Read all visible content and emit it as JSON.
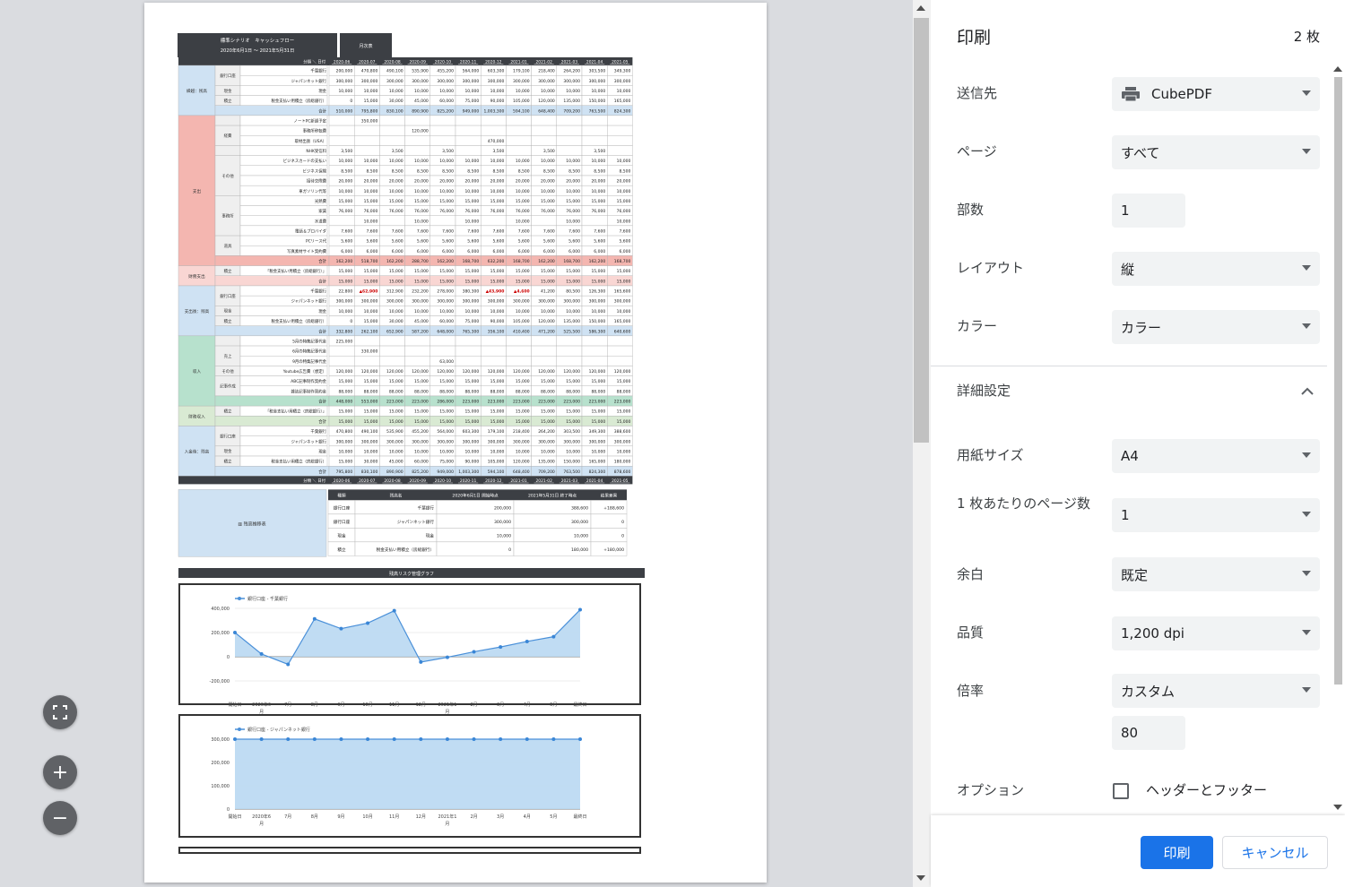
{
  "preview": {
    "scenario_title": "標準シナリオ　キャッシュフロー",
    "period": "2020年6月1日 ～ 2021年5月31日",
    "month_table_label": "月次表",
    "corner_label": "分類 ＼ 日付",
    "months": [
      "2020-06",
      "2020-07",
      "2020-08",
      "2020-09",
      "2020-10",
      "2020-11",
      "2020-12",
      "2021-01",
      "2021-02",
      "2021-03",
      "2021-04",
      "2021-05"
    ],
    "total_label": "合計",
    "groups": [
      {
        "label": "繰越：残高",
        "color": "#cfe2f3",
        "rows": [
          {
            "sub": "銀行口座",
            "item": "千葉銀行",
            "vals": [
              "200,000",
              "470,800",
              "490,100",
              "535,900",
              "455,200",
              "564,000",
              "603,300",
              "179,100",
              "218,400",
              "264,200",
              "303,500",
              "349,300"
            ]
          },
          {
            "sub": "銀行口座",
            "item": "ジャパンネット銀行",
            "vals": [
              "300,000",
              "300,000",
              "300,000",
              "300,000",
              "300,000",
              "300,000",
              "300,000",
              "300,000",
              "300,000",
              "300,000",
              "300,000",
              "300,000"
            ]
          },
          {
            "sub": "現金",
            "item": "現金",
            "vals": [
              "10,000",
              "10,000",
              "10,000",
              "10,000",
              "10,000",
              "10,000",
              "10,000",
              "10,000",
              "10,000",
              "10,000",
              "10,000",
              "10,000"
            ]
          },
          {
            "sub": "積立",
            "item": "税金支払い用積立（房総銀行）",
            "vals": [
              "0",
              "15,000",
              "30,000",
              "45,000",
              "60,000",
              "75,000",
              "90,000",
              "105,000",
              "120,000",
              "135,000",
              "150,000",
              "165,000"
            ]
          }
        ],
        "total": [
          "510,000",
          "795,800",
          "830,100",
          "890,900",
          "825,200",
          "949,000",
          "1,003,300",
          "594,100",
          "648,400",
          "709,200",
          "763,500",
          "824,300"
        ]
      },
      {
        "label": "支出",
        "color": "#f4b6b0",
        "rows": [
          {
            "sub": "",
            "item": "ノートPC新調予定",
            "vals": [
              "",
              "350,000",
              "",
              "",
              "",
              "",
              "",
              "",
              "",
              "",
              "",
              ""
            ]
          },
          {
            "sub": "経費",
            "item": "事務所移転費",
            "vals": [
              "",
              "",
              "",
              "120,000",
              "",
              "",
              "",
              "",
              "",
              "",
              "",
              ""
            ]
          },
          {
            "sub": "経費",
            "item": "取材出張（USA）",
            "vals": [
              "",
              "",
              "",
              "",
              "",
              "",
              "470,000",
              "",
              "",
              "",
              "",
              ""
            ]
          },
          {
            "sub": "",
            "item": "NHK受信料",
            "vals": [
              "3,500",
              "",
              "3,500",
              "",
              "3,500",
              "",
              "3,500",
              "",
              "3,500",
              "",
              "3,500",
              ""
            ]
          },
          {
            "sub": "その他",
            "item": "ビジネスカードの支払い",
            "vals": [
              "10,000",
              "10,000",
              "10,000",
              "10,000",
              "10,000",
              "10,000",
              "10,000",
              "10,000",
              "10,000",
              "10,000",
              "10,000",
              "10,000"
            ]
          },
          {
            "sub": "その他",
            "item": "ビジネス保険",
            "vals": [
              "8,500",
              "8,500",
              "8,500",
              "8,500",
              "8,500",
              "8,500",
              "8,500",
              "8,500",
              "8,500",
              "8,500",
              "8,500",
              "8,500"
            ]
          },
          {
            "sub": "その他",
            "item": "接待交際費",
            "vals": [
              "20,000",
              "20,000",
              "20,000",
              "20,000",
              "20,000",
              "20,000",
              "20,000",
              "20,000",
              "20,000",
              "20,000",
              "20,000",
              "20,000"
            ]
          },
          {
            "sub": "その他",
            "item": "車ガソリン代等",
            "vals": [
              "10,000",
              "10,000",
              "10,000",
              "10,000",
              "10,000",
              "10,000",
              "10,000",
              "10,000",
              "10,000",
              "10,000",
              "10,000",
              "10,000"
            ]
          },
          {
            "sub": "事務所",
            "item": "光熱費",
            "vals": [
              "15,000",
              "15,000",
              "15,000",
              "15,000",
              "15,000",
              "15,000",
              "15,000",
              "15,000",
              "15,000",
              "15,000",
              "15,000",
              "15,000"
            ]
          },
          {
            "sub": "事務所",
            "item": "家賃",
            "vals": [
              "76,000",
              "76,000",
              "76,000",
              "76,000",
              "76,000",
              "76,000",
              "76,000",
              "76,000",
              "76,000",
              "76,000",
              "76,000",
              "76,000"
            ]
          },
          {
            "sub": "事務所",
            "item": "水道費",
            "vals": [
              "",
              "10,000",
              "",
              "10,000",
              "",
              "10,000",
              "",
              "10,000",
              "",
              "10,000",
              "",
              "10,000"
            ]
          },
          {
            "sub": "事務所",
            "item": "電話＆プロバイダ",
            "vals": [
              "7,600",
              "7,600",
              "7,600",
              "7,600",
              "7,600",
              "7,600",
              "7,600",
              "7,600",
              "7,600",
              "7,600",
              "7,600",
              "7,600"
            ]
          },
          {
            "sub": "道具",
            "item": "PCリース代",
            "vals": [
              "5,600",
              "5,600",
              "5,600",
              "5,600",
              "5,600",
              "5,600",
              "5,600",
              "5,600",
              "5,600",
              "5,600",
              "5,600",
              "5,600"
            ]
          },
          {
            "sub": "道具",
            "item": "写真素材サイト契約費",
            "vals": [
              "6,000",
              "6,000",
              "6,000",
              "6,000",
              "6,000",
              "6,000",
              "6,000",
              "6,000",
              "6,000",
              "6,000",
              "6,000",
              "6,000"
            ]
          }
        ],
        "total": [
          "162,200",
          "518,700",
          "162,200",
          "288,700",
          "162,200",
          "168,700",
          "632,200",
          "168,700",
          "162,200",
          "168,700",
          "162,200",
          "168,700"
        ]
      },
      {
        "label": "財務支出",
        "color": "#f9d6d3",
        "rows": [
          {
            "sub": "積立",
            "item": "「税金支払い用積立（房総銀行）」",
            "vals": [
              "15,000",
              "15,000",
              "15,000",
              "15,000",
              "15,000",
              "15,000",
              "15,000",
              "15,000",
              "15,000",
              "15,000",
              "15,000",
              "15,000"
            ]
          }
        ],
        "total": [
          "15,000",
          "15,000",
          "15,000",
          "15,000",
          "15,000",
          "15,000",
          "15,000",
          "15,000",
          "15,000",
          "15,000",
          "15,000",
          "15,000"
        ]
      },
      {
        "label": "支出後：残高",
        "color": "#cfe2f3",
        "rows": [
          {
            "sub": "銀行口座",
            "item": "千葉銀行",
            "vals": [
              "22,800",
              "▲62,900",
              "312,900",
              "232,200",
              "278,000",
              "380,300",
              "▲43,900",
              "▲4,600",
              "41,200",
              "80,500",
              "126,300",
              "165,600"
            ]
          },
          {
            "sub": "銀行口座",
            "item": "ジャパンネット銀行",
            "vals": [
              "300,000",
              "300,000",
              "300,000",
              "300,000",
              "300,000",
              "300,000",
              "300,000",
              "300,000",
              "300,000",
              "300,000",
              "300,000",
              "300,000"
            ]
          },
          {
            "sub": "現金",
            "item": "現金",
            "vals": [
              "10,000",
              "10,000",
              "10,000",
              "10,000",
              "10,000",
              "10,000",
              "10,000",
              "10,000",
              "10,000",
              "10,000",
              "10,000",
              "10,000"
            ]
          },
          {
            "sub": "積立",
            "item": "税金支払い用積立（房総銀行）",
            "vals": [
              "0",
              "15,000",
              "30,000",
              "45,000",
              "60,000",
              "75,000",
              "90,000",
              "105,000",
              "120,000",
              "135,000",
              "150,000",
              "165,000"
            ]
          }
        ],
        "total": [
          "332,800",
          "262,100",
          "652,900",
          "587,200",
          "648,000",
          "765,300",
          "356,100",
          "410,400",
          "471,200",
          "525,500",
          "586,300",
          "640,600"
        ]
      },
      {
        "label": "収入",
        "color": "#b7e1cd",
        "rows": [
          {
            "sub": "",
            "item": "5月の特集記事代金",
            "vals": [
              "225,000",
              "",
              "",
              "",
              "",
              "",
              "",
              "",
              "",
              "",
              "",
              ""
            ]
          },
          {
            "sub": "売上",
            "item": "6月の特集記事代金",
            "vals": [
              "",
              "330,000",
              "",
              "",
              "",
              "",
              "",
              "",
              "",
              "",
              "",
              ""
            ]
          },
          {
            "sub": "売上",
            "item": "9月の特集記事代金",
            "vals": [
              "",
              "",
              "",
              "",
              "63,000",
              "",
              "",
              "",
              "",
              "",
              "",
              ""
            ]
          },
          {
            "sub": "その他",
            "item": "Youtube広告費（想定）",
            "vals": [
              "120,000",
              "120,000",
              "120,000",
              "120,000",
              "120,000",
              "120,000",
              "120,000",
              "120,000",
              "120,000",
              "120,000",
              "120,000",
              "120,000"
            ]
          },
          {
            "sub": "記事作成",
            "item": "ABC記事制作契約金",
            "vals": [
              "15,000",
              "15,000",
              "15,000",
              "15,000",
              "15,000",
              "15,000",
              "15,000",
              "15,000",
              "15,000",
              "15,000",
              "15,000",
              "15,000"
            ]
          },
          {
            "sub": "記事作成",
            "item": "雑誌記事制作契約金",
            "vals": [
              "88,000",
              "88,000",
              "88,000",
              "88,000",
              "88,000",
              "88,000",
              "88,000",
              "88,000",
              "88,000",
              "88,000",
              "88,000",
              "88,000"
            ]
          }
        ],
        "total": [
          "448,000",
          "553,000",
          "223,000",
          "223,000",
          "286,000",
          "223,000",
          "223,000",
          "223,000",
          "223,000",
          "223,000",
          "223,000",
          "223,000"
        ]
      },
      {
        "label": "財務収入",
        "color": "#d9ead3",
        "rows": [
          {
            "sub": "積立",
            "item": "「税金支払い用積立（房総銀行）」",
            "vals": [
              "15,000",
              "15,000",
              "15,000",
              "15,000",
              "15,000",
              "15,000",
              "15,000",
              "15,000",
              "15,000",
              "15,000",
              "15,000",
              "15,000"
            ]
          }
        ],
        "total": [
          "15,000",
          "15,000",
          "15,000",
          "15,000",
          "15,000",
          "15,000",
          "15,000",
          "15,000",
          "15,000",
          "15,000",
          "15,000",
          "15,000"
        ]
      },
      {
        "label": "入金後：残高",
        "color": "#cfe2f3",
        "rows": [
          {
            "sub": "銀行口座",
            "item": "千葉銀行",
            "vals": [
              "470,800",
              "490,100",
              "535,900",
              "455,200",
              "564,000",
              "603,300",
              "179,100",
              "218,400",
              "264,200",
              "303,500",
              "349,300",
              "388,600"
            ]
          },
          {
            "sub": "銀行口座",
            "item": "ジャパンネット銀行",
            "vals": [
              "300,000",
              "300,000",
              "300,000",
              "300,000",
              "300,000",
              "300,000",
              "300,000",
              "300,000",
              "300,000",
              "300,000",
              "300,000",
              "300,000"
            ]
          },
          {
            "sub": "現金",
            "item": "現金",
            "vals": [
              "10,000",
              "10,000",
              "10,000",
              "10,000",
              "10,000",
              "10,000",
              "10,000",
              "10,000",
              "10,000",
              "10,000",
              "10,000",
              "10,000"
            ]
          },
          {
            "sub": "積立",
            "item": "税金支払い用積立（房総銀行）",
            "vals": [
              "15,000",
              "30,000",
              "45,000",
              "60,000",
              "75,000",
              "90,000",
              "105,000",
              "120,000",
              "135,000",
              "150,000",
              "165,000",
              "180,000"
            ]
          }
        ],
        "total": [
          "795,800",
          "830,100",
          "890,900",
          "825,200",
          "949,000",
          "1,003,300",
          "594,100",
          "648,400",
          "709,200",
          "763,500",
          "824,300",
          "878,600"
        ]
      }
    ],
    "summary": {
      "label": "残高推移表",
      "headers": [
        "種類",
        "残高名",
        "2020年6月1日 開始時点",
        "2021年5月31日 終了時点",
        "結果差異"
      ],
      "rows": [
        [
          "銀行口座",
          "千葉銀行",
          "200,000",
          "388,600",
          "+188,600"
        ],
        [
          "銀行口座",
          "ジャパンネット銀行",
          "300,000",
          "300,000",
          "0"
        ],
        [
          "現金",
          "現金",
          "10,000",
          "10,000",
          "0"
        ],
        [
          "積立",
          "税金支払い用積立（房総銀行）",
          "0",
          "180,000",
          "+180,000"
        ]
      ]
    },
    "graph_bar_title": "残高リスク管理グラフ"
  },
  "chart_data": [
    {
      "type": "area",
      "series": [
        {
          "name": "銀行口座 - 千葉銀行",
          "values": [
            200000,
            22800,
            -62900,
            312900,
            232200,
            278000,
            380300,
            -43900,
            -4600,
            41200,
            80500,
            126300,
            165600,
            388600
          ]
        }
      ],
      "x": [
        "開始日",
        "2020年6月",
        "7月",
        "8月",
        "9月",
        "10月",
        "11月",
        "12月",
        "2021年1月",
        "2月",
        "3月",
        "4月",
        "5月",
        "最終日"
      ],
      "yticks": [
        "400,000",
        "200,000",
        "0",
        "-200,000"
      ],
      "ylim": [
        -200000,
        400000
      ],
      "legend": "top-left"
    },
    {
      "type": "area",
      "series": [
        {
          "name": "銀行口座 - ジャパンネット銀行",
          "values": [
            300000,
            300000,
            300000,
            300000,
            300000,
            300000,
            300000,
            300000,
            300000,
            300000,
            300000,
            300000,
            300000,
            300000
          ]
        }
      ],
      "x": [
        "開始日",
        "2020年6月",
        "7月",
        "8月",
        "9月",
        "10月",
        "11月",
        "12月",
        "2021年1月",
        "2月",
        "3月",
        "4月",
        "5月",
        "最終日"
      ],
      "yticks": [
        "300,000",
        "200,000",
        "100,000",
        "0"
      ],
      "ylim": [
        0,
        300000
      ],
      "legend": "top-left"
    }
  ],
  "panel": {
    "title": "印刷",
    "sheet_count": "2 枚",
    "destination_label": "送信先",
    "destination_value": "CubePDF",
    "pages_label": "ページ",
    "pages_value": "すべて",
    "copies_label": "部数",
    "copies_value": "1",
    "layout_label": "レイアウト",
    "layout_value": "縦",
    "color_label": "カラー",
    "color_value": "カラー",
    "more_settings_label": "詳細設定",
    "paper_label": "用紙サイズ",
    "paper_value": "A4",
    "pps_label": "1 枚あたりのページ数",
    "pps_value": "1",
    "margin_label": "余白",
    "margin_value": "既定",
    "quality_label": "品質",
    "quality_value": "1,200 dpi",
    "scale_label": "倍率",
    "scale_value": "カスタム",
    "scale_custom": "80",
    "options_label": "オプション",
    "header_footer_label": "ヘッダーとフッター",
    "print_button": "印刷",
    "cancel_button": "キャンセル"
  }
}
